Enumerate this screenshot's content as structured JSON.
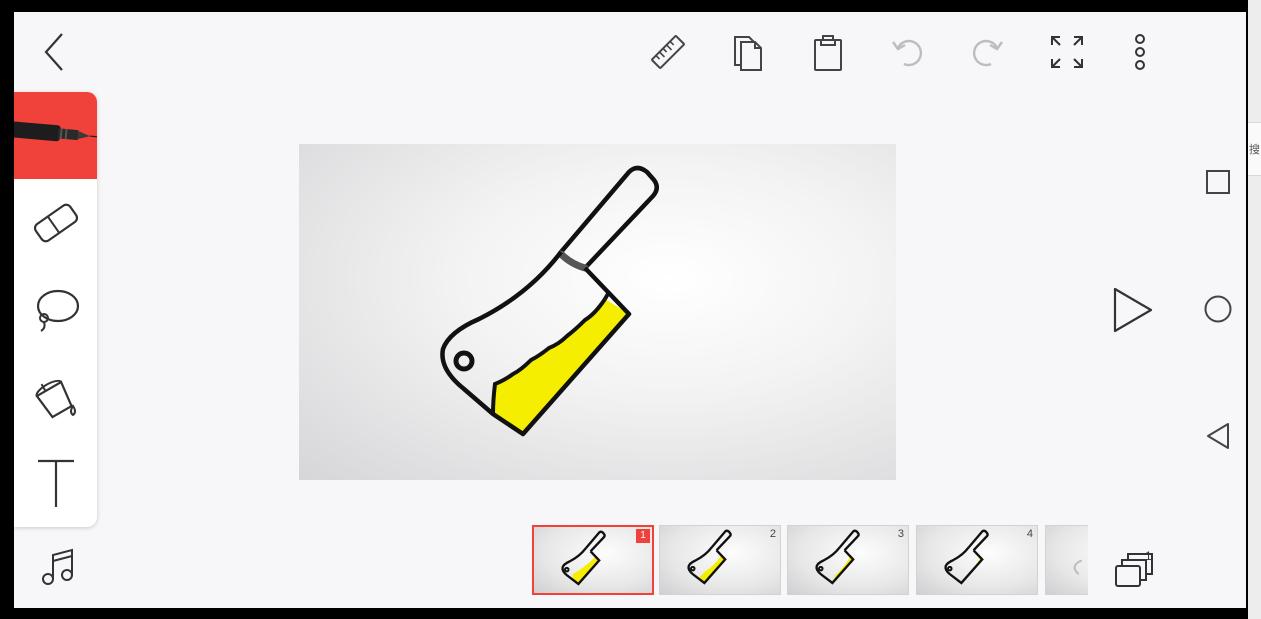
{
  "app": {
    "accent_color": "#f0413a"
  },
  "top_bar": {
    "icons": [
      "back-arrow-icon",
      "ruler-icon",
      "copy-icon",
      "paste-icon",
      "undo-icon",
      "redo-icon",
      "fullscreen-icon",
      "more-vertical-icon"
    ]
  },
  "toolbox": {
    "active_tool": "pen",
    "tools": [
      "pen",
      "eraser",
      "lasso",
      "fill",
      "text"
    ],
    "music_icon": "music-note-icon"
  },
  "canvas": {
    "drawing": "cleaver-knife-sketch",
    "fill_color": "#f6ee00"
  },
  "timeline": {
    "frames": [
      {
        "number": "1",
        "selected": true
      },
      {
        "number": "2",
        "selected": false
      },
      {
        "number": "3",
        "selected": false
      },
      {
        "number": "4",
        "selected": false
      }
    ],
    "layers_count": "1"
  },
  "system_nav": {
    "icons": [
      "square-recents-icon",
      "circle-home-icon",
      "triangle-back-icon"
    ]
  },
  "side_panel": {
    "glyph": "搜"
  }
}
